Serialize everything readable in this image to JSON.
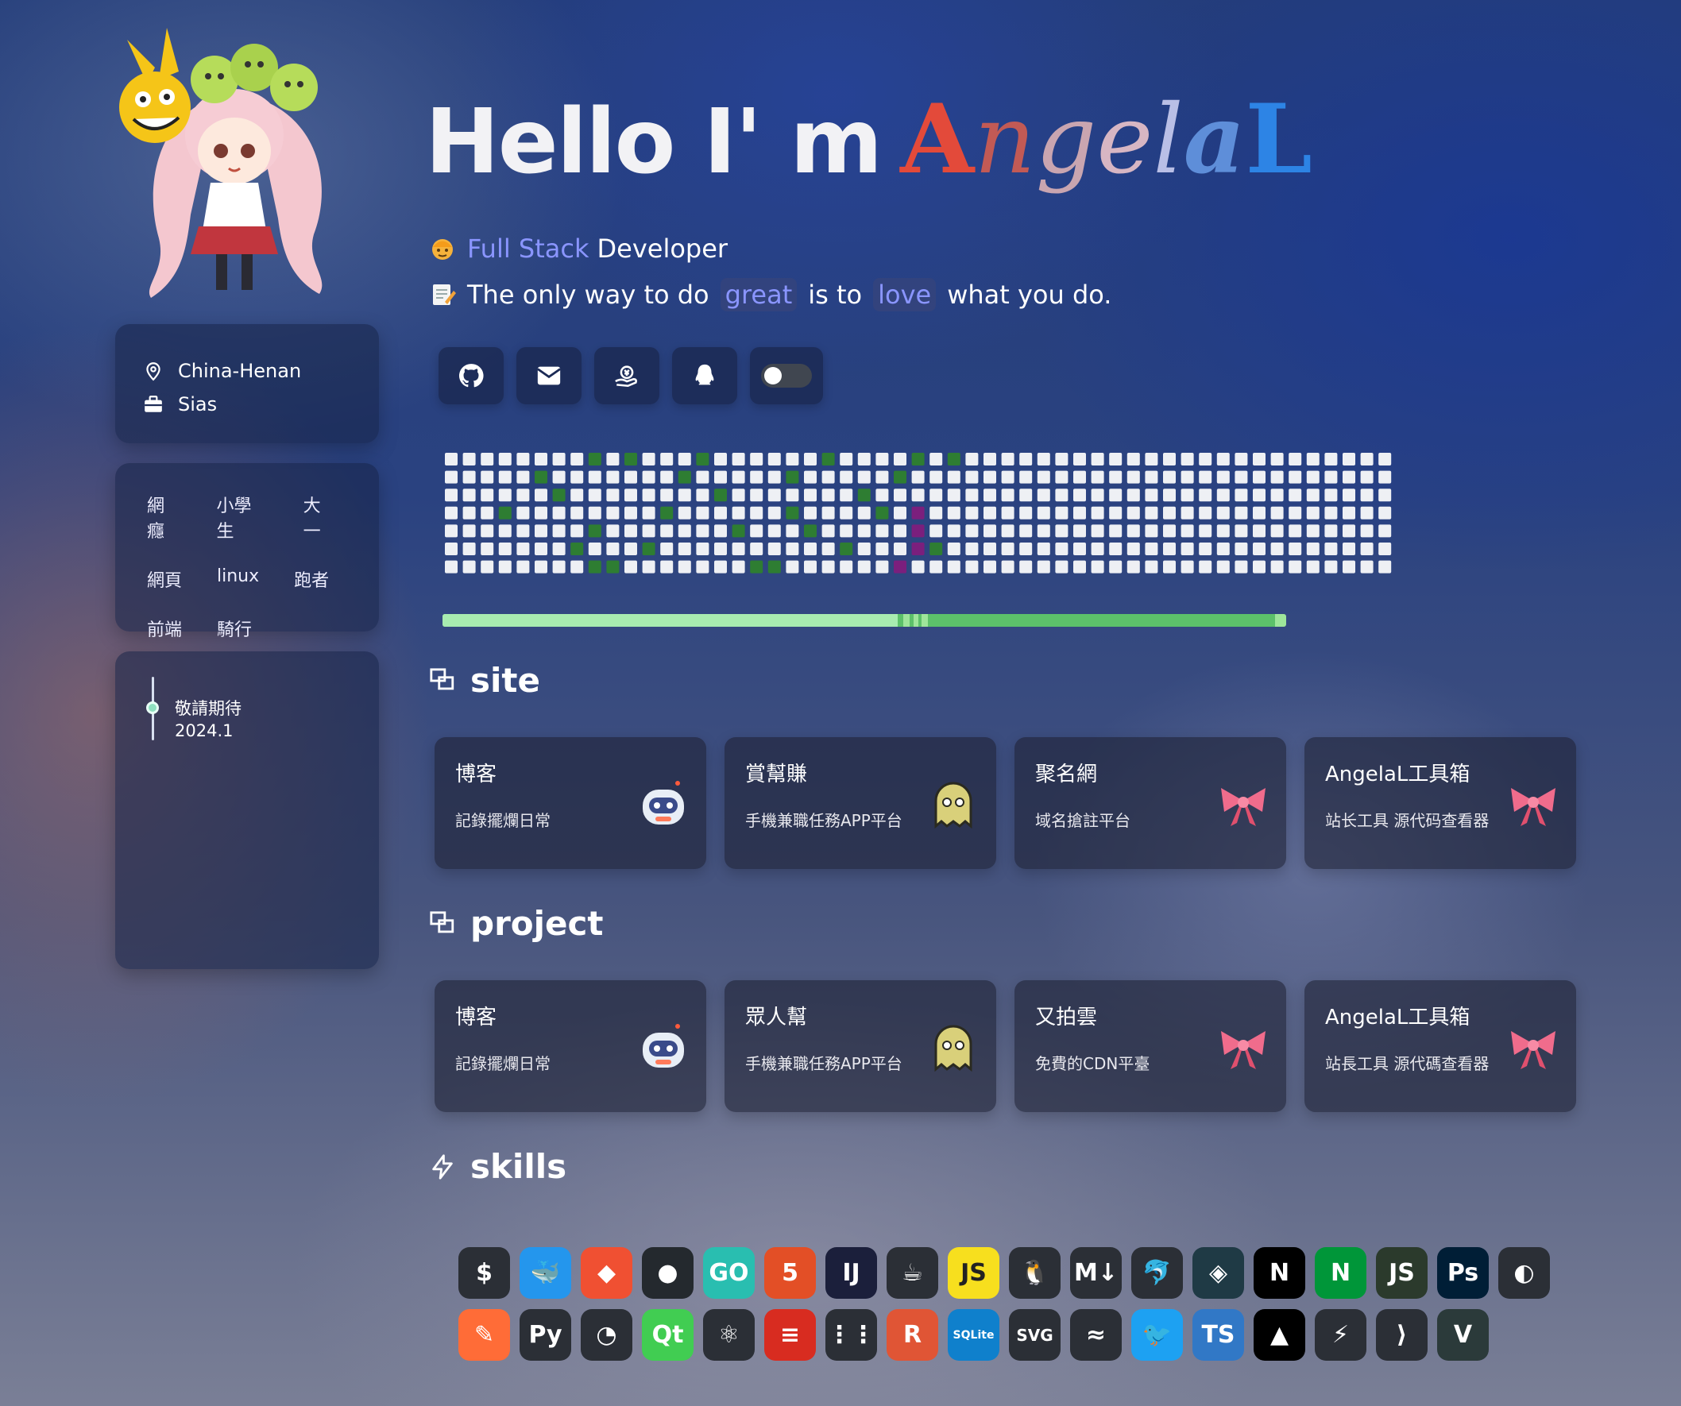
{
  "header": {
    "greeting": "Hello I' m",
    "name_letters": [
      "A",
      "n",
      "g",
      "e",
      "l",
      "a",
      "L"
    ]
  },
  "intro": {
    "role_accent": "Full Stack",
    "role_rest": "Developer",
    "quote_part1": "The only way to do",
    "quote_hl1": "great",
    "quote_part2": "is to",
    "quote_hl2": "love",
    "quote_part3": "what you do."
  },
  "social_icons": [
    "github-icon",
    "mail-icon",
    "sponsor-icon",
    "qq-icon"
  ],
  "theme_toggle": {
    "on": false
  },
  "info": {
    "location": "China-Henan",
    "work": "Sias"
  },
  "tags": [
    [
      "網癮",
      "小學生",
      "大一"
    ],
    [
      "網頁",
      "linux",
      "跑者"
    ],
    [
      "前端",
      "騎行"
    ]
  ],
  "timeline": {
    "title": "敬請期待",
    "date": "2024.1"
  },
  "colors": {
    "accent": "#8a95ff",
    "cell_empty": "#eef0f4",
    "cell_green": "#2e7d32",
    "cell_purple": "#7b1f7d"
  },
  "sections": {
    "site": {
      "title": "site",
      "cards": [
        {
          "title": "博客",
          "desc": "記錄擺爛日常",
          "icon": "robot-icon"
        },
        {
          "title": "賞幫賺",
          "desc": "手機兼職任務APP平台",
          "icon": "ghost-icon"
        },
        {
          "title": "聚名網",
          "desc": "域名搶註平台",
          "icon": "bow-icon"
        },
        {
          "title": "AngelaL工具箱",
          "desc": "站长工具 源代码查看器",
          "icon": "bow-icon"
        }
      ]
    },
    "project": {
      "title": "project",
      "cards": [
        {
          "title": "博客",
          "desc": "記錄擺爛日常",
          "icon": "robot-icon"
        },
        {
          "title": "眾人幫",
          "desc": "手機兼職任務APP平台",
          "icon": "ghost-icon"
        },
        {
          "title": "又拍雲",
          "desc": "免費的CDN平臺",
          "icon": "bow-icon"
        },
        {
          "title": "AngelaL工具箱",
          "desc": "站長工具 源代碼查看器",
          "icon": "bow-icon"
        }
      ]
    },
    "skills": {
      "title": "skills"
    }
  },
  "skills_row1": [
    {
      "name": "bash-icon",
      "label": "$",
      "bg": "#2b2f36"
    },
    {
      "name": "docker-icon",
      "label": "🐳",
      "bg": "#2496ed"
    },
    {
      "name": "git-icon",
      "label": "◆",
      "bg": "#f05032"
    },
    {
      "name": "github-icon",
      "label": "●",
      "bg": "#24292e"
    },
    {
      "name": "go-icon",
      "label": "GO",
      "bg": "#29beb0"
    },
    {
      "name": "html5-icon",
      "label": "5",
      "bg": "#e34f26"
    },
    {
      "name": "intellij-icon",
      "label": "IJ",
      "bg": "#1b1f3b"
    },
    {
      "name": "java-icon",
      "label": "☕",
      "bg": "#2b2f36"
    },
    {
      "name": "javascript-icon",
      "label": "JS",
      "bg": "#f7df1e"
    },
    {
      "name": "linux-icon",
      "label": "🐧",
      "bg": "#2b2f36"
    },
    {
      "name": "markdown-icon",
      "label": "M↓",
      "bg": "#2b2f36"
    },
    {
      "name": "mysql-icon",
      "label": "🐬",
      "bg": "#2b2f36"
    },
    {
      "name": "netlify-icon",
      "label": "◈",
      "bg": "#1f3a45"
    },
    {
      "name": "nextjs-icon",
      "label": "N",
      "bg": "#000000"
    },
    {
      "name": "nginx-icon",
      "label": "N",
      "bg": "#009639"
    },
    {
      "name": "nodejs-icon",
      "label": "JS",
      "bg": "#2b3a2c"
    },
    {
      "name": "photoshop-icon",
      "label": "Ps",
      "bg": "#001e36"
    },
    {
      "name": "planetscale-icon",
      "label": "◐",
      "bg": "#2b2f36"
    }
  ],
  "skills_row2": [
    {
      "name": "postman-icon",
      "label": "✎",
      "bg": "#ff6c37"
    },
    {
      "name": "python-icon",
      "label": "Py",
      "bg": "#2b2f36"
    },
    {
      "name": "pytorch-icon",
      "label": "◔",
      "bg": "#2b2f36"
    },
    {
      "name": "qt-icon",
      "label": "Qt",
      "bg": "#41cd52"
    },
    {
      "name": "react-icon",
      "label": "⚛",
      "bg": "#2b2f36"
    },
    {
      "name": "redis-icon",
      "label": "≡",
      "bg": "#d82c20"
    },
    {
      "name": "rollup-icon",
      "label": "⋮⋮",
      "bg": "#2b2f36"
    },
    {
      "name": "rust-icon",
      "label": "R",
      "bg": "#e05535"
    },
    {
      "name": "sqlite-icon",
      "label": "SQLite",
      "bg": "#0f80cc"
    },
    {
      "name": "svg-icon",
      "label": "SVG",
      "bg": "#2b2f36"
    },
    {
      "name": "tailwind-icon",
      "label": "≈",
      "bg": "#2b2f36"
    },
    {
      "name": "twitter-icon",
      "label": "🐦",
      "bg": "#1da1f2"
    },
    {
      "name": "typescript-icon",
      "label": "TS",
      "bg": "#3178c6"
    },
    {
      "name": "vercel-icon",
      "label": "▲",
      "bg": "#000000"
    },
    {
      "name": "vite-icon",
      "label": "⚡",
      "bg": "#2b2f36"
    },
    {
      "name": "vscode-icon",
      "label": "⟩",
      "bg": "#2b2f36"
    },
    {
      "name": "vue-icon",
      "label": "V",
      "bg": "#2b3a3a"
    }
  ]
}
